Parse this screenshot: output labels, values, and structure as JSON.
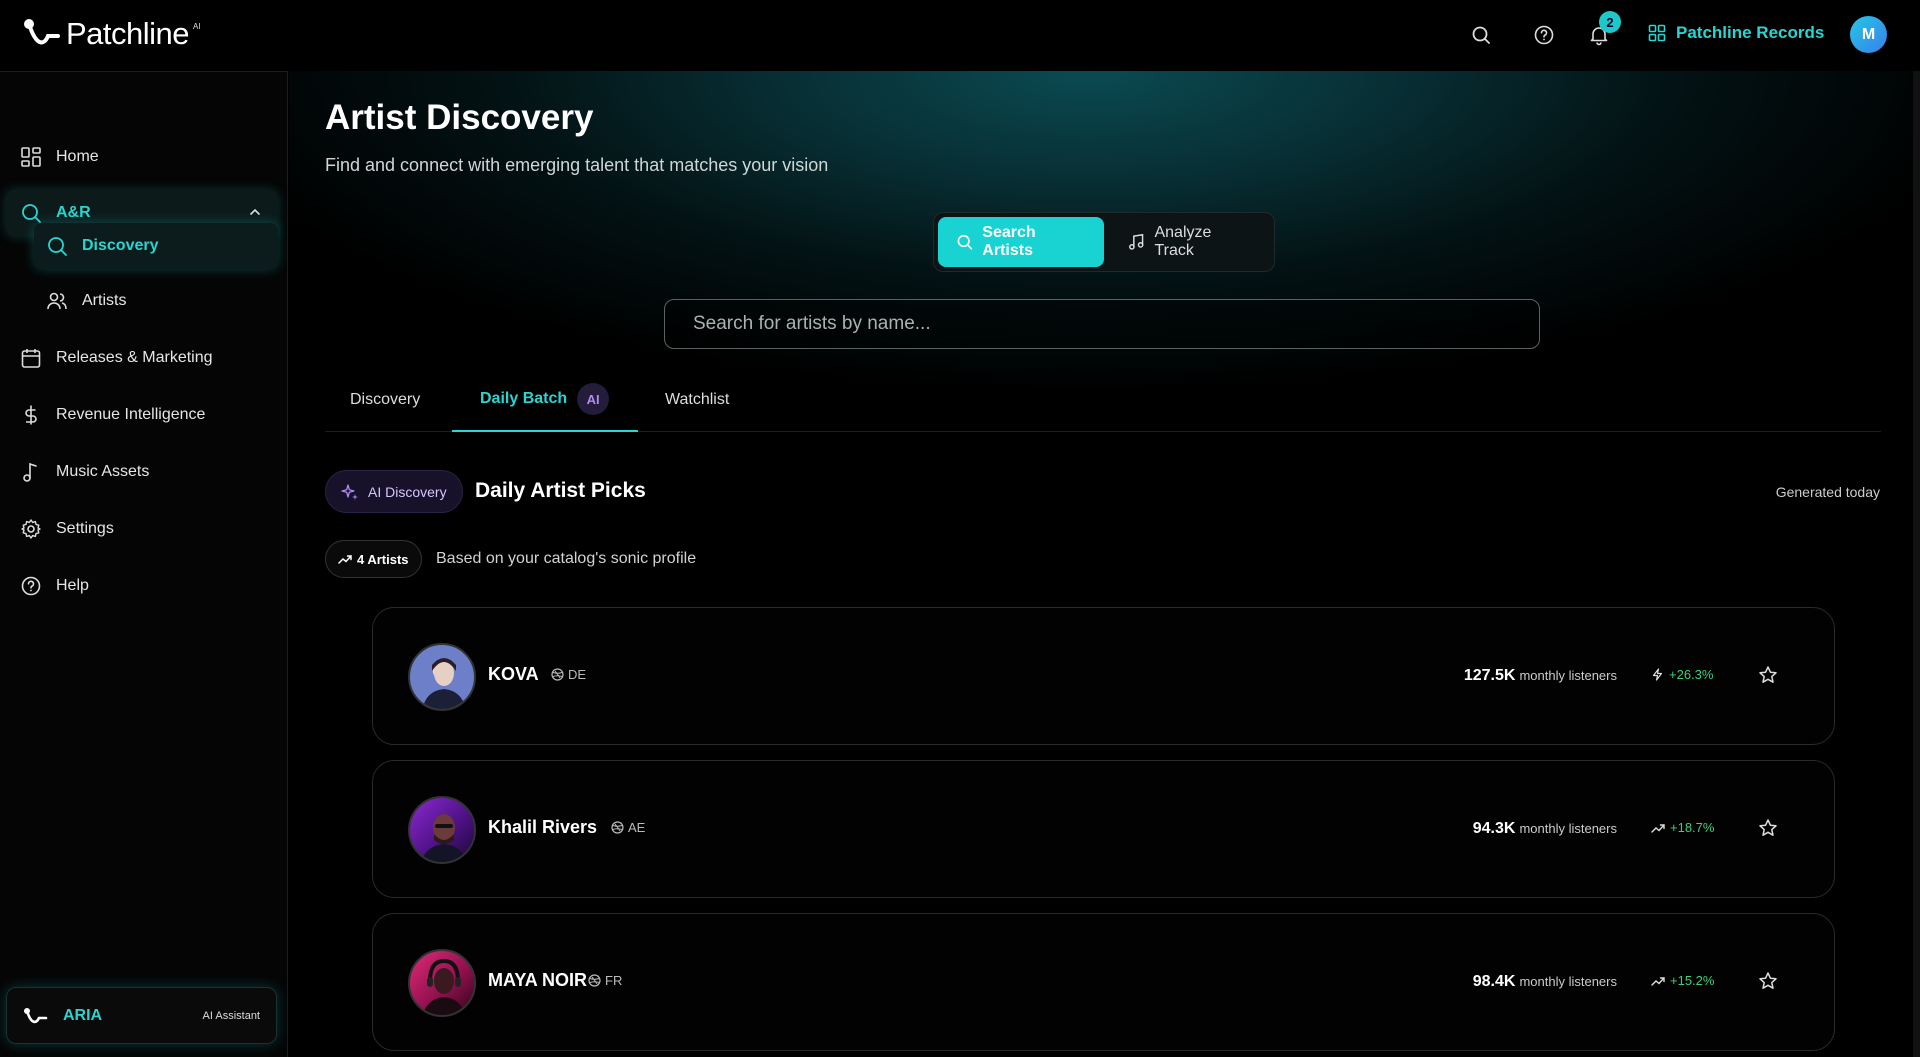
{
  "app": {
    "name": "Patchline",
    "name_badge": "AI"
  },
  "topbar": {
    "notification_count": "2",
    "org_name": "Patchline Records",
    "avatar_initial": "M"
  },
  "sidebar": {
    "items": [
      {
        "label": "Home"
      },
      {
        "label": "A&R"
      },
      {
        "label": "Discovery"
      },
      {
        "label": "Artists"
      },
      {
        "label": "Releases & Marketing"
      },
      {
        "label": "Revenue Intelligence"
      },
      {
        "label": "Music Assets"
      },
      {
        "label": "Settings"
      },
      {
        "label": "Help"
      }
    ],
    "assistant": {
      "name": "ARIA",
      "subtitle": "AI Assistant"
    }
  },
  "page": {
    "title": "Artist Discovery",
    "subtitle": "Find and connect with emerging talent that matches your vision",
    "toggle": {
      "search_label": "Search Artists",
      "analyze_label": "Analyze Track"
    },
    "search": {
      "placeholder": "Search for artists by name..."
    },
    "tabs": [
      {
        "label": "Discovery"
      },
      {
        "label": "Daily Batch",
        "badge": "AI"
      },
      {
        "label": "Watchlist"
      }
    ],
    "picks": {
      "badge": "AI Discovery",
      "title": "Daily Artist Picks",
      "generated": "Generated today",
      "count": "4 Artists",
      "based_on": "Based on your catalog's sonic profile"
    },
    "artists": [
      {
        "name": "KOVA",
        "country": "DE",
        "listeners": "127.5K",
        "listeners_label": "monthly listeners",
        "growth": "+26.3%",
        "growth_icon": "lightning-icon"
      },
      {
        "name": "Khalil Rivers",
        "country": "AE",
        "listeners": "94.3K",
        "listeners_label": "monthly listeners",
        "growth": "+18.7%",
        "growth_icon": "trending-up-icon"
      },
      {
        "name": "MAYA NOIR",
        "country": "FR",
        "listeners": "98.4K",
        "listeners_label": "monthly listeners",
        "growth": "+15.2%",
        "growth_icon": "trending-up-icon"
      }
    ]
  },
  "colors": {
    "accent": "#2ad4d0",
    "growth": "#3ecf7a",
    "ai_purple": "#b28af0"
  }
}
